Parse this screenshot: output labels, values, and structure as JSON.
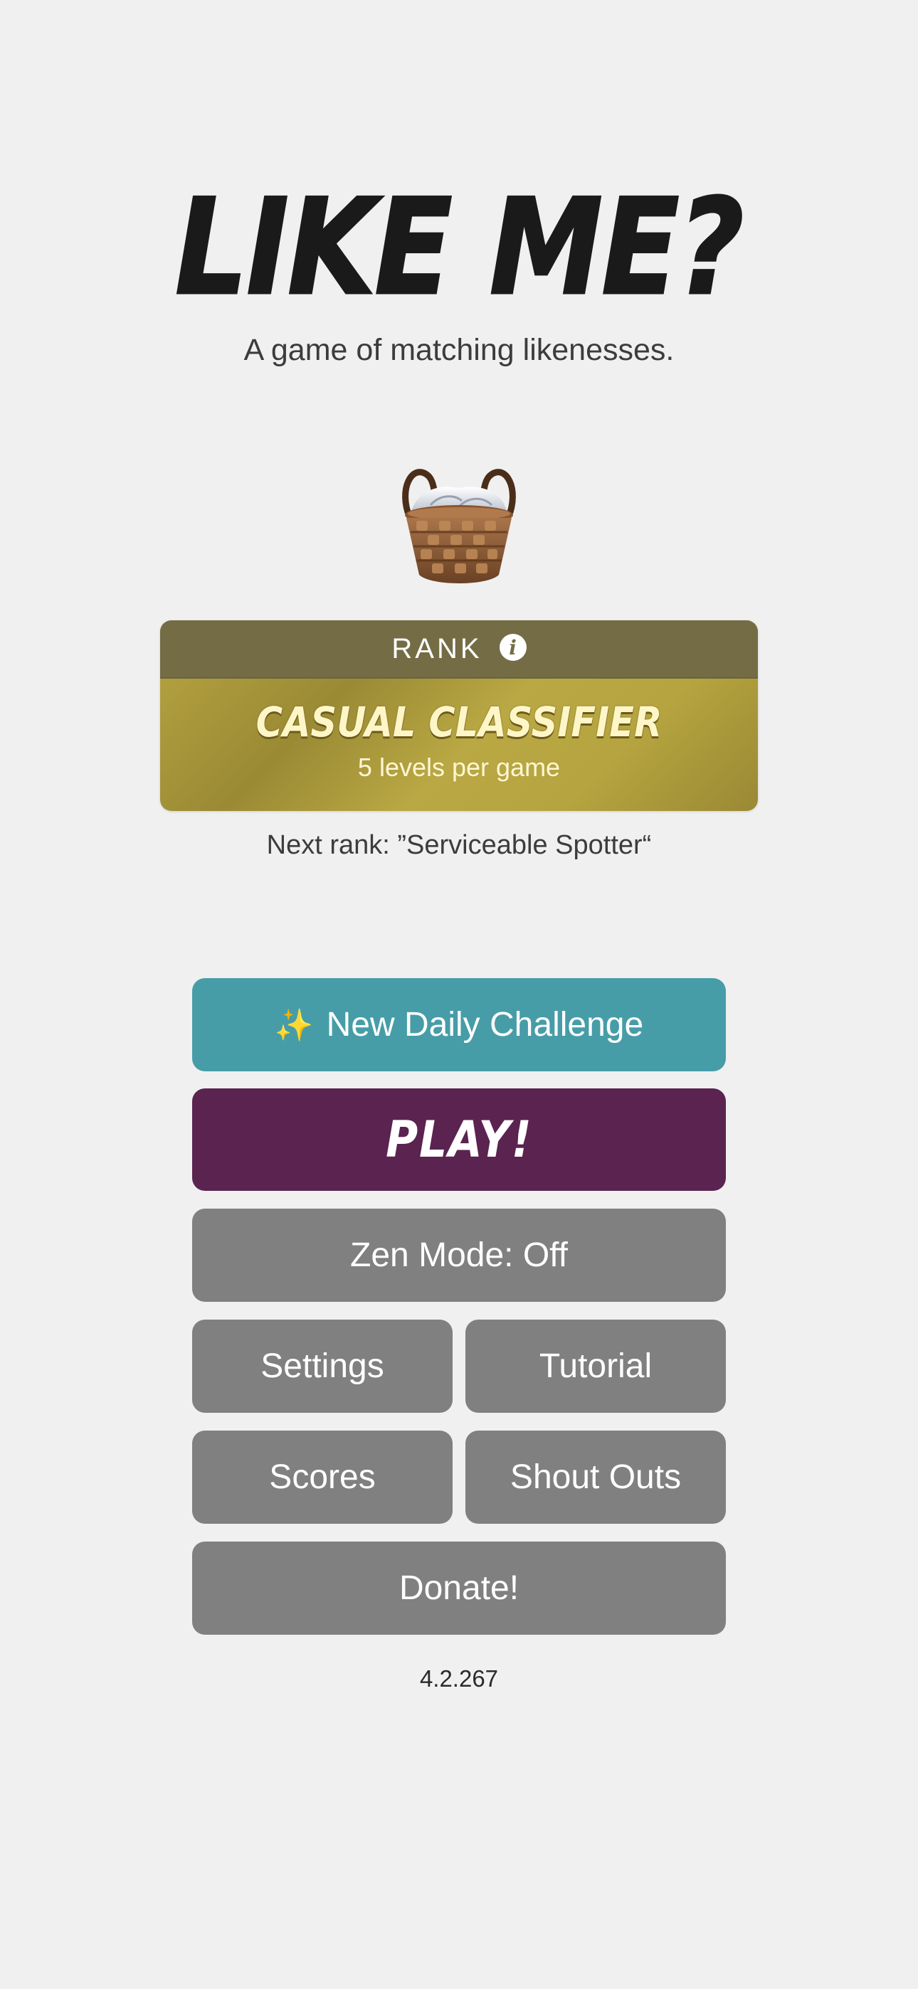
{
  "header": {
    "title": "LIKE ME?",
    "subtitle": "A game of matching likenesses."
  },
  "rank": {
    "label": "RANK",
    "name": "CASUAL CLASSIFIER",
    "detail": "5 levels per game",
    "next_rank": "Next rank: ”Serviceable Spotter“",
    "icon": "basket-icon",
    "accent_color": "#b5a43f"
  },
  "menu": {
    "daily_icon": "✨",
    "daily_label": "New Daily Challenge",
    "play_label": "PLAY!",
    "zen_label": "Zen Mode: Off",
    "settings_label": "Settings",
    "tutorial_label": "Tutorial",
    "scores_label": "Scores",
    "shout_outs_label": "Shout Outs",
    "donate_label": "Donate!"
  },
  "colors": {
    "daily": "#469da8",
    "play": "#5a2350",
    "secondary": "#808080",
    "background": "#f0f0f0"
  },
  "version": "4.2.267"
}
